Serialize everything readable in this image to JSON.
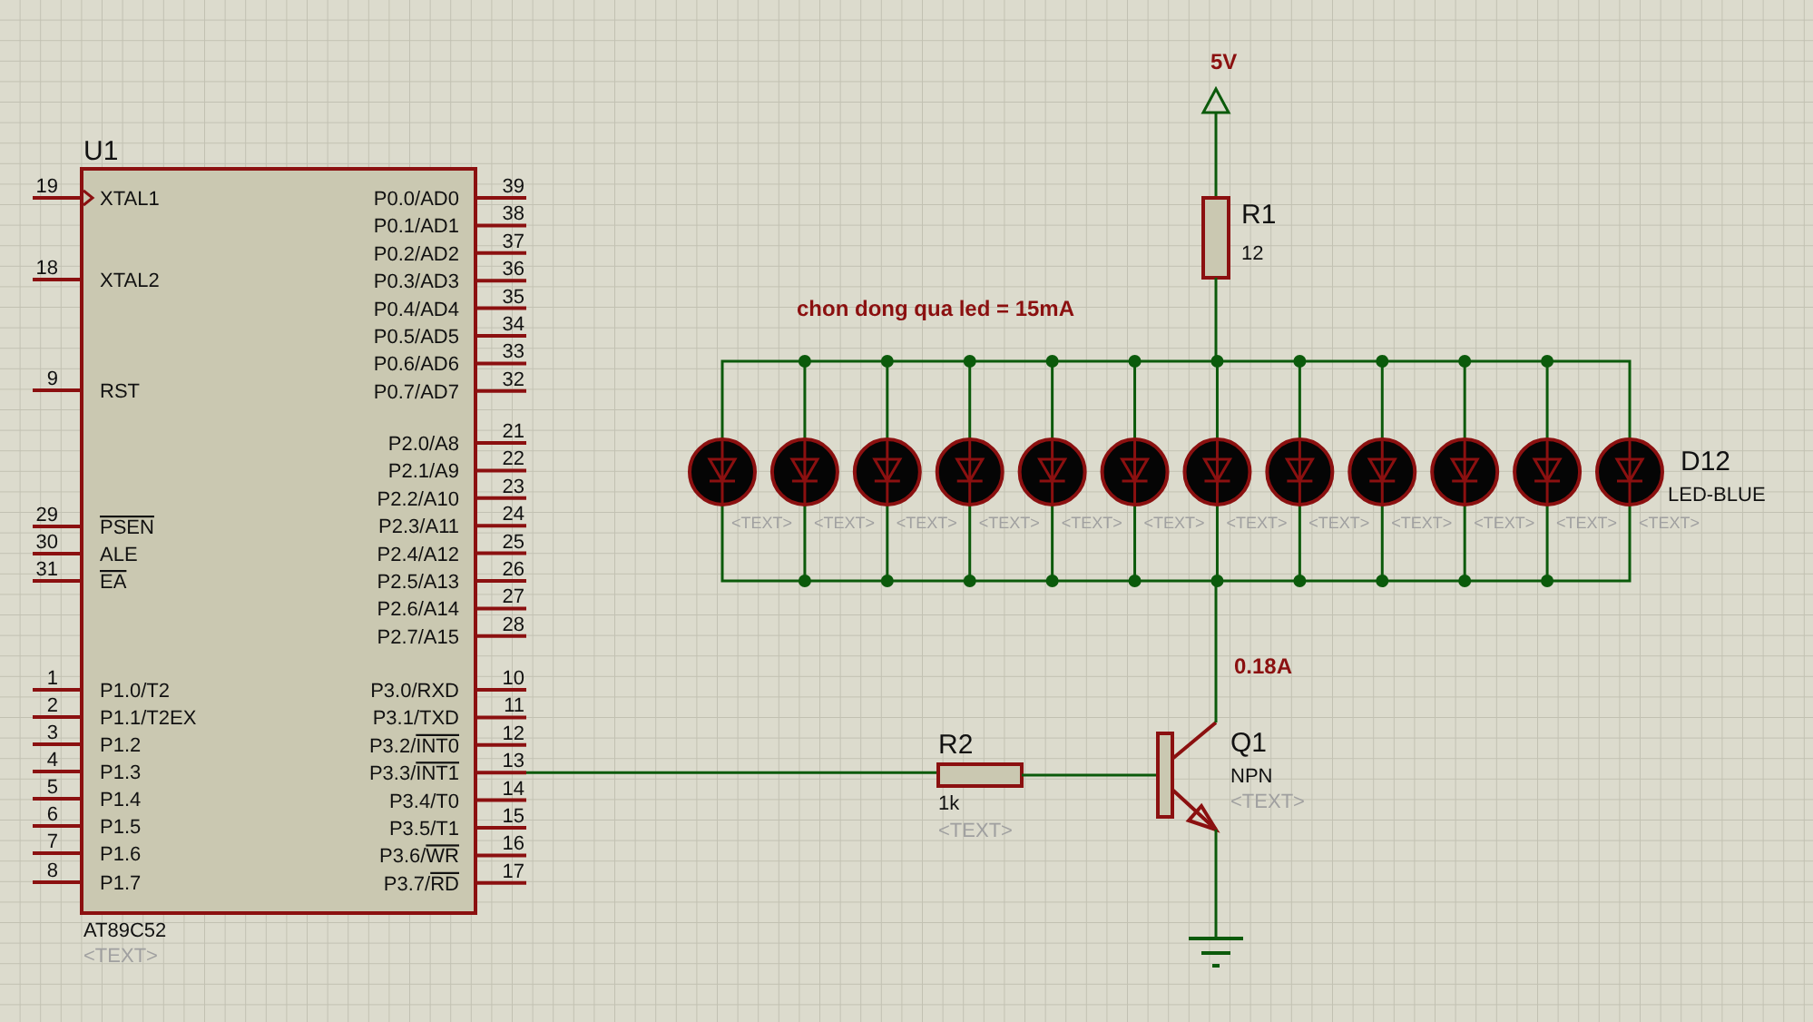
{
  "chip": {
    "ref": "U1",
    "part": "AT89C52",
    "text": "<TEXT>",
    "left_pins": [
      {
        "num": "19",
        "label": "XTAL1",
        "clock": true
      },
      {
        "num": "18",
        "label": "XTAL2"
      },
      {
        "num": "9",
        "label": "RST"
      },
      {
        "num": "29",
        "over": "PSEN"
      },
      {
        "num": "30",
        "label": "ALE"
      },
      {
        "num": "31",
        "over": "EA"
      },
      {
        "num": "1",
        "label": "P1.0/T2"
      },
      {
        "num": "2",
        "label": "P1.1/T2EX"
      },
      {
        "num": "3",
        "label": "P1.2"
      },
      {
        "num": "4",
        "label": "P1.3"
      },
      {
        "num": "5",
        "label": "P1.4"
      },
      {
        "num": "6",
        "label": "P1.5"
      },
      {
        "num": "7",
        "label": "P1.6"
      },
      {
        "num": "8",
        "label": "P1.7"
      }
    ],
    "right_pins": [
      {
        "num": "39",
        "label": "P0.0/AD0"
      },
      {
        "num": "38",
        "label": "P0.1/AD1"
      },
      {
        "num": "37",
        "label": "P0.2/AD2"
      },
      {
        "num": "36",
        "label": "P0.3/AD3"
      },
      {
        "num": "35",
        "label": "P0.4/AD4"
      },
      {
        "num": "34",
        "label": "P0.5/AD5"
      },
      {
        "num": "33",
        "label": "P0.6/AD6"
      },
      {
        "num": "32",
        "label": "P0.7/AD7"
      },
      {
        "num": "21",
        "label": "P2.0/A8"
      },
      {
        "num": "22",
        "label": "P2.1/A9"
      },
      {
        "num": "23",
        "label": "P2.2/A10"
      },
      {
        "num": "24",
        "label": "P2.3/A11"
      },
      {
        "num": "25",
        "label": "P2.4/A12"
      },
      {
        "num": "26",
        "label": "P2.5/A13"
      },
      {
        "num": "27",
        "label": "P2.6/A14"
      },
      {
        "num": "28",
        "label": "P2.7/A15"
      },
      {
        "num": "10",
        "label": "P3.0/RXD"
      },
      {
        "num": "11",
        "label": "P3.1/TXD"
      },
      {
        "num": "12",
        "label": "P3.2/",
        "over": "INT0"
      },
      {
        "num": "13",
        "label": "P3.3/",
        "over": "INT1",
        "connected": true
      },
      {
        "num": "14",
        "label": "P3.4/T0"
      },
      {
        "num": "15",
        "label": "P3.5/T1"
      },
      {
        "num": "16",
        "label": "P3.6/",
        "over": "WR"
      },
      {
        "num": "17",
        "label": "P3.7/",
        "over": "RD"
      }
    ]
  },
  "supply": {
    "label": "5V"
  },
  "r1": {
    "ref": "R1",
    "value": "12"
  },
  "note": "chon dong qua led = 15mA",
  "leds": [
    {
      "text": "<TEXT>"
    },
    {
      "text": "<TEXT>"
    },
    {
      "text": "<TEXT>"
    },
    {
      "text": "<TEXT>"
    },
    {
      "text": "<TEXT>"
    },
    {
      "text": "<TEXT>"
    },
    {
      "text": "<TEXT>"
    },
    {
      "text": "<TEXT>"
    },
    {
      "text": "<TEXT>"
    },
    {
      "text": "<TEXT>"
    },
    {
      "text": "<TEXT>"
    },
    {
      "text": "<TEXT>"
    }
  ],
  "last_led": {
    "ref": "D12",
    "part": "LED-BLUE"
  },
  "r2": {
    "ref": "R2",
    "value": "1k",
    "text": "<TEXT>"
  },
  "q1": {
    "ref": "Q1",
    "type": "NPN",
    "text": "<TEXT>"
  },
  "current": "0.18A"
}
